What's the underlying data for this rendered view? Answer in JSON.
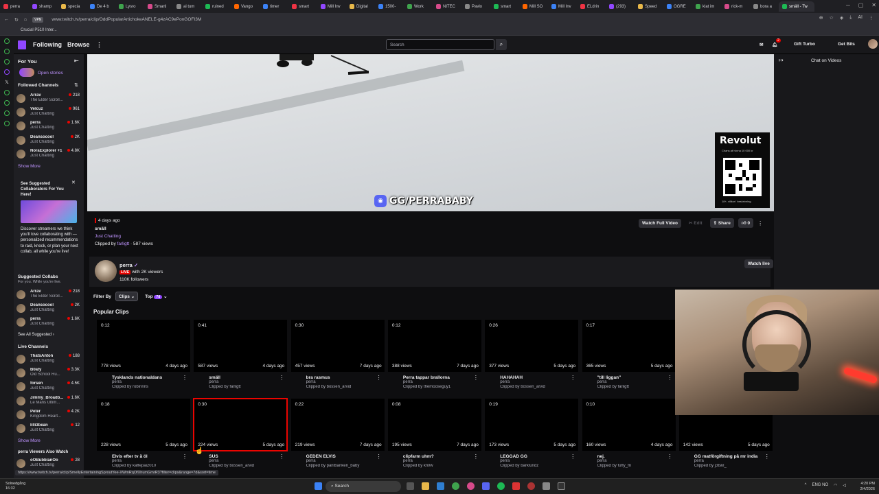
{
  "browser": {
    "tabs": [
      "perra",
      "shamp",
      "specia",
      "De 4 b",
      "Lysro",
      "Smarti",
      "ai tum",
      "ruined",
      "Vango",
      "timer",
      "smart",
      "Mill Inv",
      "Digital",
      "1500-",
      "Work",
      "NITEC",
      "Pavlo",
      "smart",
      "Mill SO",
      "Mill Inv",
      "ELdrin",
      "(293)",
      "Speed",
      "OGRE",
      "klat im",
      "rick-m",
      "bora a",
      "smäll - Tw"
    ],
    "url": "www.twitch.tv/perra/clip/OddPopularArtichokeANELE-g4zAC9ePonGOFI3M",
    "vpn_label": "VPN",
    "bookmark": "Crucial P510 Inter..."
  },
  "nav": {
    "following": "Following",
    "browse": "Browse",
    "more": "⋮",
    "search_placeholder": "Search",
    "gift_turbo": "Gift Turbo",
    "get_bits": "Get Bits",
    "notif_count": "2"
  },
  "sidebar": {
    "for_you": "For You",
    "open_stories": "Open stories",
    "followed_header": "Followed Channels",
    "followed": [
      {
        "name": "Arrav",
        "game": "The Elder Scroll...",
        "viewers": "218"
      },
      {
        "name": "Velcuz",
        "game": "Just Chatting",
        "viewers": "961"
      },
      {
        "name": "perra",
        "game": "Just Chatting",
        "viewers": "1.6K"
      },
      {
        "name": "Deansocool",
        "game": "Just Chatting",
        "viewers": "2K"
      },
      {
        "name": "NoraExplorer +1",
        "game": "Just Chatting",
        "viewers": "4.8K"
      }
    ],
    "show_more": "Show More",
    "promo_title": "See Suggested Collaborators For You Here!",
    "promo_text": "Discover streamers we think you'll love collaborating with — personalized recommendations to raid, knock, or plan your next collab, all while you're live!",
    "suggested_header": "Suggested Collabs",
    "suggested_sub": "For you. While you're live.",
    "suggested": [
      {
        "name": "Arrav",
        "game": "The Elder Scroll...",
        "viewers": "218"
      },
      {
        "name": "Deansocool",
        "game": "Just Chatting",
        "viewers": "2K"
      },
      {
        "name": "perra",
        "game": "Just Chatting",
        "viewers": "1.6K"
      }
    ],
    "see_all_suggested": "See All Suggested",
    "live_header": "Live Channels",
    "live": [
      {
        "name": "ThatsAnton",
        "game": "Just Chatting",
        "viewers": "188"
      },
      {
        "name": "B0aty",
        "game": "Old School Ru...",
        "viewers": "3.3K"
      },
      {
        "name": "forsen",
        "game": "Just Chatting",
        "viewers": "4.5K"
      },
      {
        "name": "Jimmy_Broadb...",
        "game": "Le Mans Ultim...",
        "viewers": "1.6K"
      },
      {
        "name": "Peter",
        "game": "Kingdom Heart...",
        "viewers": "4.2K"
      },
      {
        "name": "lilli3bean",
        "game": "Just Chatting",
        "viewers": "12"
      }
    ],
    "show_more_live": "Show More",
    "also_watch_header": "perra Viewers Also Watch",
    "also_watch": [
      {
        "name": "oOBubblanOo",
        "game": "Just Chatting",
        "viewers": "28"
      }
    ]
  },
  "video": {
    "overlay_text": "GG/PERRABABY",
    "ad_brand": "Revolut",
    "ad_sub": "Chans att vinna 10 000 kr",
    "ad_footer": "18+, villkor i beskrivning"
  },
  "chat": {
    "label": "Chat on Videos"
  },
  "clip": {
    "age": "4 days ago",
    "title": "smäll",
    "category": "Just Chatting",
    "clipped_by_prefix": "Clipped by",
    "clipper": "farligtt",
    "views": "· 587 views",
    "watch_full": "Watch Full Video",
    "edit": "Edit",
    "share": "Share",
    "likes": "0"
  },
  "channel": {
    "name": "perra",
    "live_badge": "LIVE",
    "viewers_text": "with 2K viewers",
    "followers": "110K followers",
    "watch_live": "Watch live"
  },
  "filters": {
    "label": "Filter By",
    "type": "Clips",
    "sort": "Top",
    "sort_tag": "7d"
  },
  "popular_header": "Popular Clips",
  "clips_row1": [
    {
      "dur": "0:12",
      "views": "778 views",
      "ago": "4 days ago",
      "title": "Tysklands nationaldans",
      "channel": "perra",
      "by": "Clipped by robinnns"
    },
    {
      "dur": "0:41",
      "views": "587 views",
      "ago": "4 days ago",
      "title": "smäll",
      "channel": "perra",
      "by": "Clipped by farligtt"
    },
    {
      "dur": "0:30",
      "views": "457 views",
      "ago": "7 days ago",
      "title": "bra rasmus",
      "channel": "perra",
      "by": "Clipped by bossen_arvid"
    },
    {
      "dur": "0:12",
      "views": "388 views",
      "ago": "7 days ago",
      "title": "Perra tappar brallorna",
      "channel": "perra",
      "by": "Clipped by themooseguy1"
    },
    {
      "dur": "0:26",
      "views": "377 views",
      "ago": "5 days ago",
      "title": "HAHAHAH",
      "channel": "perra",
      "by": "Clipped by bossen_arvid"
    },
    {
      "dur": "0:17",
      "views": "365 views",
      "ago": "5 days ago",
      "title": "\"till liggan\"",
      "channel": "perra",
      "by": "Clipped by farligtt"
    }
  ],
  "clips_row2": [
    {
      "dur": "0:18",
      "views": "228 views",
      "ago": "5 days ago",
      "title": "Elvis efter tv å öl",
      "channel": "perra",
      "by": "Clipped by kaffepai2010"
    },
    {
      "dur": "0:30",
      "views": "224 views",
      "ago": "5 days ago",
      "title": "SUS",
      "channel": "perra",
      "by": "Clipped by bossen_arvid"
    },
    {
      "dur": "0:22",
      "views": "219 views",
      "ago": "7 days ago",
      "title": "GEDEN ELVIS",
      "channel": "perra",
      "by": "Clipped by pantbanken_baby"
    },
    {
      "dur": "0:08",
      "views": "195 views",
      "ago": "7 days ago",
      "title": "clipfarm uhm?",
      "channel": "perra",
      "by": "Clipped by kfi0w"
    },
    {
      "dur": "0:19",
      "views": "173 views",
      "ago": "5 days ago",
      "title": "LEGGAD GG",
      "channel": "perra",
      "by": "Clipped by barklundz"
    },
    {
      "dur": "0:10",
      "views": "160 views",
      "ago": "4 days ago",
      "title": "nej.",
      "channel": "perra",
      "by": "Clipped by fuffy_fn"
    },
    {
      "dur": "",
      "views": "142 views",
      "ago": "5 days ago",
      "title": "GG matförgiftning på mr india",
      "channel": "perra",
      "by": "Clipped by j3tskl_"
    }
  ],
  "status_url": "https://www.twitch.tv/perra/clip/SmellyEntertainingSproutYee-XWmRqOfXhumGmrR3?filter=clips&range=7d&sort=time",
  "taskbar": {
    "weather": "Solnedgång",
    "weather_sub": "16:32",
    "search": "Search",
    "lang": "ENG",
    "lang2": "NO",
    "time": "4:20 PM",
    "date": "2/4/2026"
  },
  "colors": {
    "twitch_purple": "#9147ff",
    "live_red": "#eb0400",
    "bg": "#0e0e10"
  }
}
